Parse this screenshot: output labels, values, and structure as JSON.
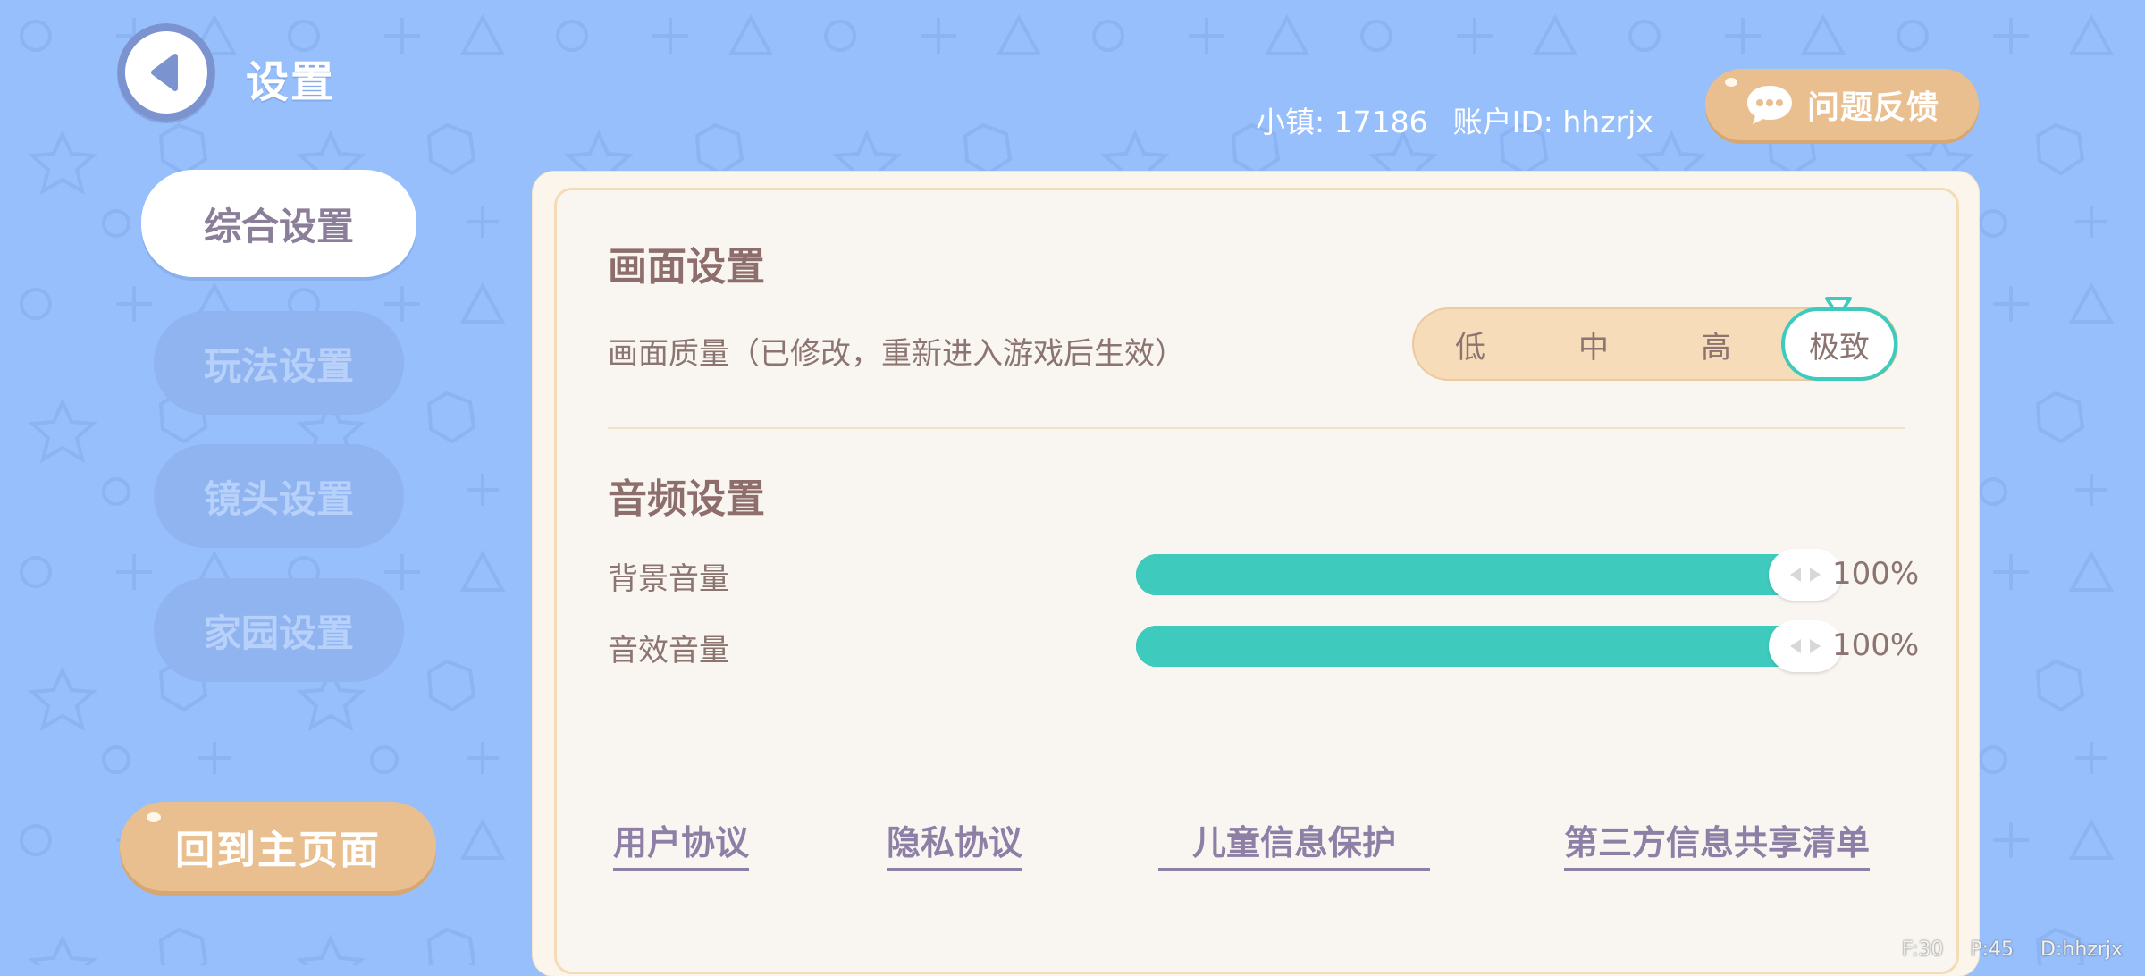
{
  "header": {
    "title": "设置",
    "town": "小镇: 17186",
    "account": "账户ID: hhzrjx",
    "feedback_label": "问题反馈"
  },
  "sidebar": {
    "items": [
      {
        "label": "综合设置",
        "active": true
      },
      {
        "label": "玩法设置",
        "active": false
      },
      {
        "label": "镜头设置",
        "active": false
      },
      {
        "label": "家园设置",
        "active": false
      }
    ],
    "home_button": "回到主页面"
  },
  "graphics": {
    "section_title": "画面设置",
    "quality_label": "画面质量（已修改，重新进入游戏后生效）",
    "options": [
      "低",
      "中",
      "高",
      "极致"
    ],
    "selected": "极致"
  },
  "audio": {
    "section_title": "音频设置",
    "sliders": [
      {
        "label": "背景音量",
        "value_text": "100%",
        "value": 1.0
      },
      {
        "label": "音效音量",
        "value_text": "100%",
        "value": 1.0
      }
    ]
  },
  "footer_links": [
    "用户协议",
    "隐私协议",
    "儿童信息保护",
    "第三方信息共享清单"
  ],
  "debug": {
    "f": "F:30",
    "p": "P:45",
    "d": "D:hhzrjx"
  },
  "colors": {
    "background": "#97bffb",
    "accent_teal": "#3ecabd",
    "button_tan": "#e9bf8f",
    "panel": "#f9f6f1"
  }
}
